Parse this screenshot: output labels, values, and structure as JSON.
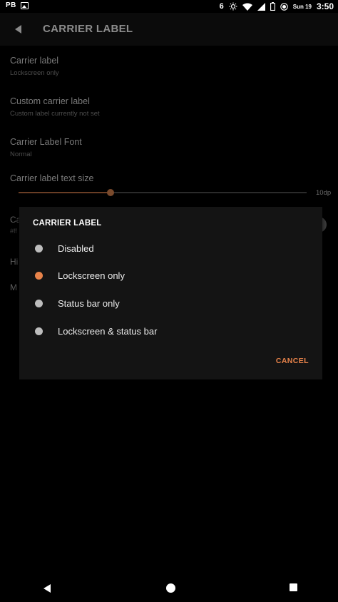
{
  "status_bar": {
    "left_text": "PB",
    "notification_count": "6",
    "date": "Sun 19",
    "time": "3:50",
    "icons": [
      "image-icon",
      "brightness-icon",
      "wifi-icon",
      "signal-icon",
      "battery-icon",
      "record-icon"
    ]
  },
  "app_bar": {
    "title": "CARRIER LABEL"
  },
  "settings": {
    "items": [
      {
        "title": "Carrier label",
        "summary": "Lockscreen only"
      },
      {
        "title": "Custom carrier label",
        "summary": "Custom label currently not set"
      },
      {
        "title": "Carrier Label Font",
        "summary": "Normal"
      }
    ],
    "text_size": {
      "title": "Carrier label text size",
      "value_label": "10dp",
      "fraction": 0.32
    },
    "partial_item_title": "Ca",
    "partial_item_summary": "#ff",
    "partial_item_2": "Hi",
    "partial_item_3": "M"
  },
  "dialog": {
    "title": "CARRIER LABEL",
    "options": [
      {
        "label": "Disabled",
        "selected": false
      },
      {
        "label": "Lockscreen only",
        "selected": true
      },
      {
        "label": "Status bar only",
        "selected": false
      },
      {
        "label": "Lockscreen & status bar",
        "selected": false
      }
    ],
    "cancel_label": "CANCEL"
  },
  "colors": {
    "accent": "#e8834a",
    "dialog_bg": "#141414",
    "radio_unselected": "#bdbdbd"
  }
}
